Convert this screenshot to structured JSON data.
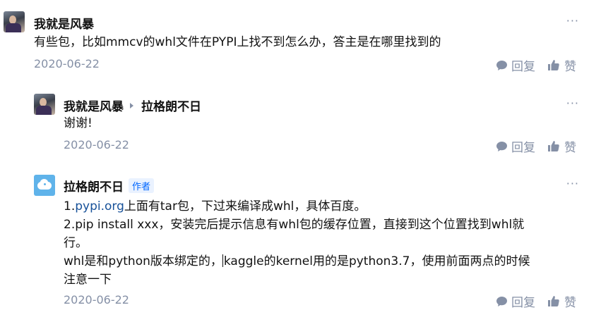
{
  "comments": [
    {
      "author": "我就是风暴",
      "text": "有些包，比如mmcv的whl文件在PYPI上找不到怎么办，答主是在哪里找到的",
      "date": "2020-06-22",
      "more": "···",
      "reply_label": "回复",
      "like_label": "赞"
    },
    {
      "author": "我就是风暴",
      "reply_to": "拉格朗不日",
      "text": "谢谢!",
      "date": "2020-06-22",
      "more": "···",
      "reply_label": "回复",
      "like_label": "赞"
    },
    {
      "author": "拉格朗不日",
      "badge": "作者",
      "lines": {
        "l1_num": "1.",
        "l1_link": "pypi.org",
        "l1_rest": "上面有tar包，下过来编译成whl，具体百度。",
        "l2": "2.pip install xxx，安装完后提示信息有whl包的缓存位置，直接到这个位置找到whl就",
        "l3": "行。",
        "l4_a": "whl是和python版本绑定的，",
        "l4_b": "kaggle的kernel用的是python3.7，使用前面两点的时候",
        "l5": "注意一下"
      },
      "date": "2020-06-22",
      "more": "···",
      "reply_label": "回复",
      "like_label": "赞"
    }
  ],
  "icons": {
    "reply": "comment-bubble-icon",
    "like": "thumbs-up-icon",
    "more": "more-dots-icon",
    "arrow": "reply-arrow-icon"
  },
  "colors": {
    "meta": "#8590a6",
    "link": "#175199",
    "badge": "#0066ff",
    "badge_bg": "#eaf2ff"
  }
}
